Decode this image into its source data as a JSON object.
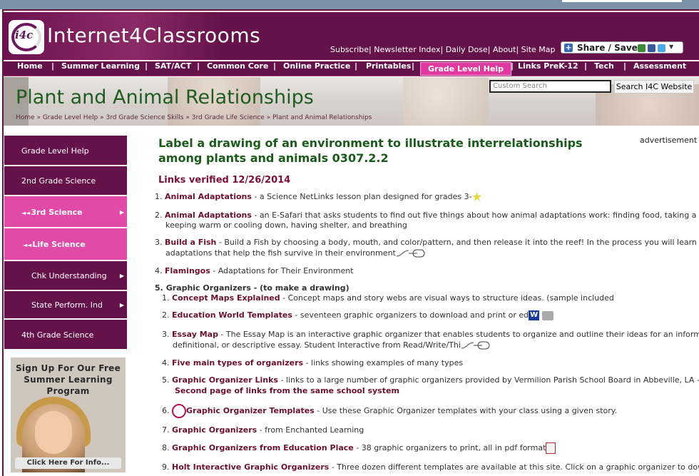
{
  "site": {
    "logo_text": "Internet4Classrooms",
    "logo_badge": "i4c"
  },
  "toplinks": [
    "Subscribe",
    "Newsletter Index",
    "Daily Dose",
    "About",
    "Site Map"
  ],
  "share": {
    "label": "Share / Save"
  },
  "nav": {
    "items": [
      "Home",
      "Summer Learning",
      "SAT/ACT",
      "Common Core",
      "Online Practice",
      "Printables",
      "Grade Level Help",
      "Links PreK-12",
      "Tech",
      "Assessment"
    ],
    "active": "Grade Level Help"
  },
  "banner": {
    "title": "Plant and Animal Relationships",
    "breadcrumb": [
      "Home",
      "Grade Level Help",
      "3rd Grade Science Skills",
      "3rd Grade Life Science",
      "Plant and Animal Relationships"
    ]
  },
  "search": {
    "placeholder": "Custom Search",
    "button": "Search I4C Website"
  },
  "sidebar": {
    "items": [
      {
        "label": "Grade Level Help"
      },
      {
        "label": "2nd Grade Science"
      },
      {
        "label": "3rd Science"
      },
      {
        "label": "Life Science"
      },
      {
        "label": "Chk Understanding"
      },
      {
        "label": "State Perform. Ind"
      },
      {
        "label": "4th Grade Science"
      }
    ]
  },
  "promo": {
    "text": "Sign Up For Our Free Summer Learning Program",
    "cta": "Click Here For Info..."
  },
  "main": {
    "advertisement": "advertisement",
    "heading": "Label a drawing of an environment to illustrate interrelationships among plants and animals 0307.2.2",
    "verified": "Links verified 12/26/2014",
    "list": [
      {
        "num": "1.",
        "link": "Animal Adaptations",
        "text": " - a Science NetLinks lesson plan designed for grades 3-"
      },
      {
        "num": "2.",
        "link": "Animal Adaptations",
        "text": " - an E-Safari that asks students to find out five things about how animal adaptations work: finding food, taking a drink,",
        "text2": "keeping warm or cooling down, having shelter, and breathing"
      },
      {
        "num": "3.",
        "link": "Build a Fish",
        "text": " - Build a Fish by choosing a body, mouth, and color/pattern, and then release it into the reef! In the process you will learn about",
        "text2": "adaptations that help the fish survive in their environment"
      },
      {
        "num": "4.",
        "link": "Flamingos",
        "text": " - Adaptations for Their Environment"
      },
      {
        "num": "5.",
        "label": "Graphic Organizers - (to make a drawing)"
      }
    ],
    "sublist": [
      {
        "num": "1.",
        "link": "Concept Maps Explained",
        "text": " - Concept maps and story webs are visual ways to structure ideas. (sample included"
      },
      {
        "num": "2.",
        "link": "Education World Templates",
        "text": " - seventeen graphic organizers to download and print or ed"
      },
      {
        "num": "3.",
        "link": "Essay Map",
        "text": " - The Essay Map is an interactive graphic organizer that enables students to organize and outline their ideas for an informatio",
        "text2": "definitional, or descriptive essay. Student Interactive from Read/Write/Thi"
      },
      {
        "num": "4.",
        "link": "Five main types of organizers",
        "text": " - links showing examples of many types"
      },
      {
        "num": "5.",
        "link": "Graphic Organizer Links",
        "text": " - links to a large number of graphic organizers provided by Vermilion Parish School Board in Abbeville, LA -",
        "link2": "Second page of links from the same school system"
      },
      {
        "num": "6.",
        "link": "Graphic Organizer Templates",
        "text": " - Use these Graphic Organizer templates with your class using a given story."
      },
      {
        "num": "7.",
        "link": "Graphic Organizers",
        "text": " - from Enchanted Learning"
      },
      {
        "num": "8.",
        "link": "Graphic Organizers from Education Place",
        "text": " - 38 graphic organizers to print, all in pdf format"
      },
      {
        "num": "9.",
        "link": "Holt Interactive Graphic Organizers",
        "text": " - Three dozen different templates are available at this site. Click on a graphic organizer to download"
      }
    ]
  }
}
